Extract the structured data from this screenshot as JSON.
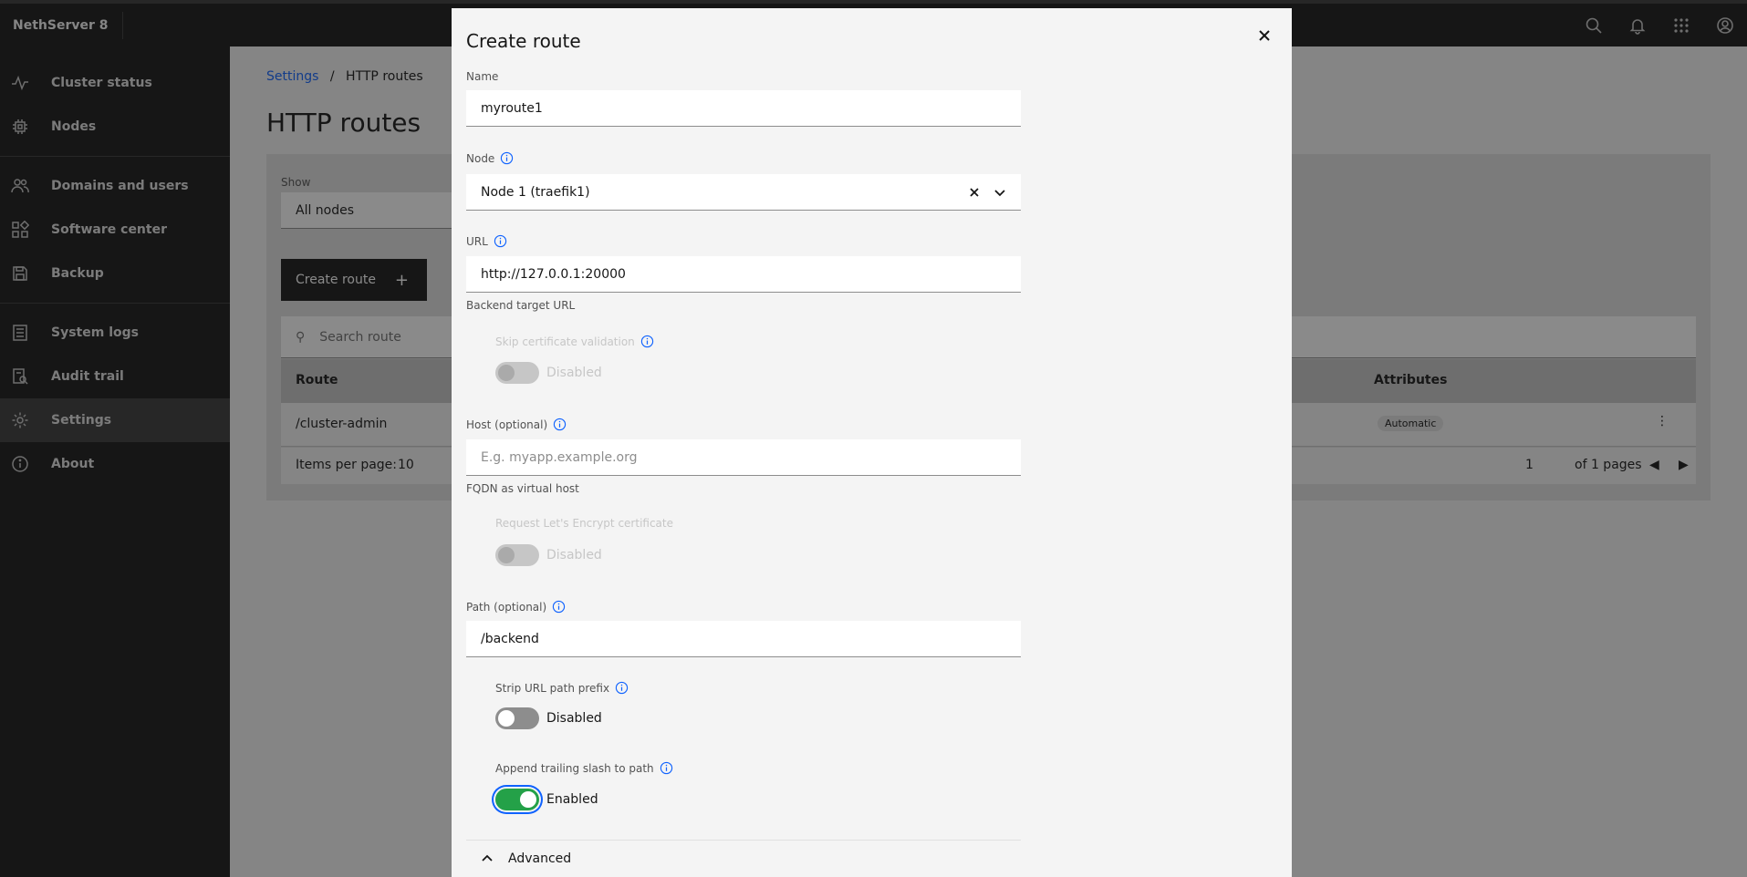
{
  "header": {
    "brand": "NethServer 8"
  },
  "sidebar": {
    "items": [
      {
        "label": "Cluster status",
        "icon": "activity-icon"
      },
      {
        "label": "Nodes",
        "icon": "chip-icon"
      },
      {
        "label": "Domains and users",
        "icon": "users-icon"
      },
      {
        "label": "Software center",
        "icon": "apps-icon"
      },
      {
        "label": "Backup",
        "icon": "save-icon"
      },
      {
        "label": "System logs",
        "icon": "logs-icon"
      },
      {
        "label": "Audit trail",
        "icon": "audit-icon"
      },
      {
        "label": "Settings",
        "icon": "gear-icon"
      },
      {
        "label": "About",
        "icon": "info-icon"
      }
    ]
  },
  "background": {
    "breadcrumb_root": "Settings",
    "breadcrumb_sep": "/",
    "breadcrumb_current": "HTTP routes",
    "page_title": "HTTP routes",
    "show_label": "Show",
    "show_value": "All nodes",
    "create_button": "Create route",
    "search_placeholder": "Search route",
    "col_route": "Route",
    "col_attributes": "Attributes",
    "row_route": "/cluster-admin",
    "row_badge": "Automatic",
    "items_per_page_label": "Items per page:",
    "items_per_page_value": "10",
    "page_value": "1",
    "page_total": "of 1 pages"
  },
  "modal": {
    "title": "Create route",
    "name_label": "Name",
    "name_value": "myroute1",
    "node_label": "Node",
    "node_value": "Node 1 (traefik1)",
    "url_label": "URL",
    "url_value": "http://127.0.0.1:20000",
    "url_helper": "Backend target URL",
    "skip_cert_label": "Skip certificate validation",
    "skip_cert_state": "Disabled",
    "host_label": "Host (optional)",
    "host_placeholder": "E.g. myapp.example.org",
    "host_helper": "FQDN as virtual host",
    "lets_encrypt_label": "Request Let's Encrypt certificate",
    "lets_encrypt_state": "Disabled",
    "path_label": "Path (optional)",
    "path_value": "/backend",
    "strip_label": "Strip URL path prefix",
    "strip_state": "Disabled",
    "append_label": "Append trailing slash to path",
    "append_state": "Enabled",
    "advanced_label": "Advanced"
  }
}
